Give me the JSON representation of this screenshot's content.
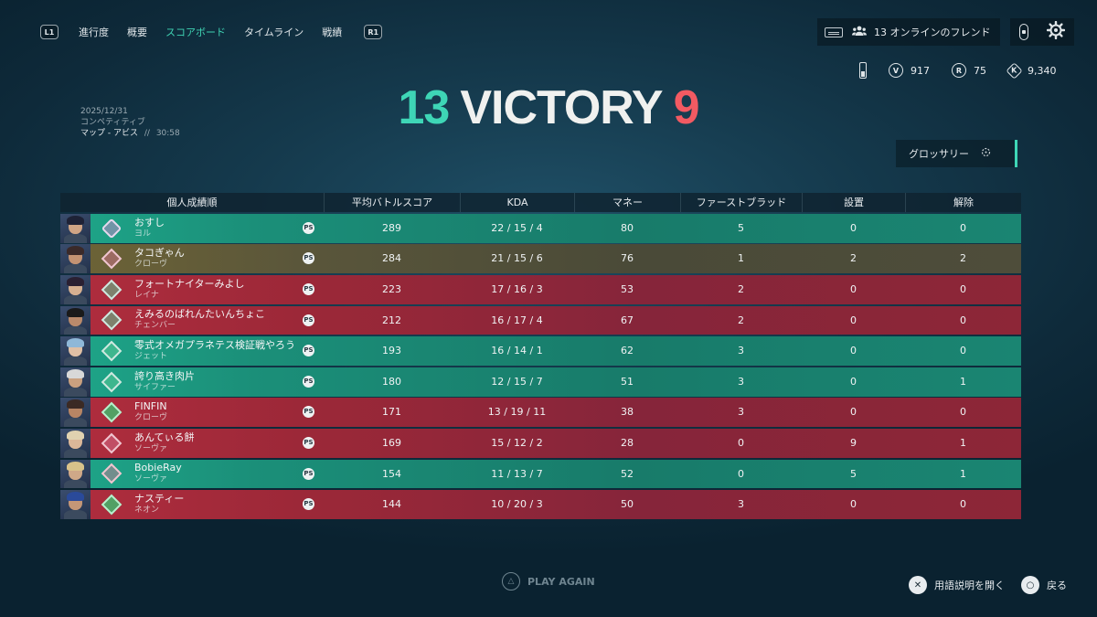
{
  "nav": {
    "left_bumper": "L1",
    "right_bumper": "R1",
    "tabs": [
      {
        "label": "進行度",
        "active": false
      },
      {
        "label": "概要",
        "active": false
      },
      {
        "label": "スコアボード",
        "active": true
      },
      {
        "label": "タイムライン",
        "active": false
      },
      {
        "label": "戦績",
        "active": false
      }
    ]
  },
  "friends": {
    "label": "13 オンラインのフレンド"
  },
  "currencies": [
    {
      "icon": "valorant-points-icon",
      "glyph": "V",
      "value": "917"
    },
    {
      "icon": "radianite-icon",
      "glyph": "R",
      "value": "75"
    },
    {
      "icon": "kingdom-credits-icon",
      "glyph": "K",
      "value": "9,340"
    }
  ],
  "match": {
    "date": "2025/12/31",
    "mode": "コンペティティブ",
    "map": "マップ - アビス",
    "separator": "//",
    "duration": "30:58",
    "score_ally": "13",
    "result": "VICTORY",
    "score_enemy": "9"
  },
  "glossary": {
    "label": "グロッサリー"
  },
  "table": {
    "headers": [
      "個人成績順",
      "平均バトルスコア",
      "KDA",
      "マネー",
      "ファーストブラッド",
      "設置",
      "解除"
    ],
    "rows": [
      {
        "team": "ally",
        "rank": "radiant",
        "name": "おすし",
        "agent": "ヨル",
        "acs": "289",
        "kda": "22 / 15 / 4",
        "money": "80",
        "fb": "5",
        "plants": "0",
        "defuses": "0"
      },
      {
        "team": "self",
        "rank": "star",
        "name": "タコぎゃん",
        "agent": "クローヴ",
        "acs": "284",
        "kda": "21 / 15 / 6",
        "money": "76",
        "fb": "1",
        "plants": "2",
        "defuses": "2"
      },
      {
        "team": "enemy",
        "rank": "ascendant",
        "name": "フォートナイターみよし",
        "agent": "レイナ",
        "acs": "223",
        "kda": "17 / 16 / 3",
        "money": "53",
        "fb": "2",
        "plants": "0",
        "defuses": "0"
      },
      {
        "team": "enemy",
        "rank": "ascendant",
        "name": "えみるのばれんたいんちょこ",
        "agent": "チェンバー",
        "acs": "212",
        "kda": "16 / 17 / 4",
        "money": "67",
        "fb": "2",
        "plants": "0",
        "defuses": "0"
      },
      {
        "team": "ally",
        "rank": "ascendant",
        "name": "零式オメガプラネテス検証戦やろう",
        "agent": "ジェット",
        "acs": "193",
        "kda": "16 / 14 / 1",
        "money": "62",
        "fb": "3",
        "plants": "0",
        "defuses": "0"
      },
      {
        "team": "ally",
        "rank": "ascendant",
        "name": "誇り高き肉片",
        "agent": "サイファー",
        "acs": "180",
        "kda": "12 / 15 / 7",
        "money": "51",
        "fb": "3",
        "plants": "0",
        "defuses": "1"
      },
      {
        "team": "enemy",
        "rank": "emerald",
        "name": "FINFIN",
        "agent": "クローヴ",
        "acs": "171",
        "kda": "13 / 19 / 11",
        "money": "38",
        "fb": "3",
        "plants": "0",
        "defuses": "0"
      },
      {
        "team": "enemy",
        "rank": "star",
        "name": "あんてぃる餅",
        "agent": "ソーヴァ",
        "acs": "169",
        "kda": "15 / 12 / 2",
        "money": "28",
        "fb": "0",
        "plants": "9",
        "defuses": "1"
      },
      {
        "team": "ally",
        "rank": "star",
        "name": "BobieRay",
        "agent": "ソーヴァ",
        "acs": "154",
        "kda": "11 / 13 / 7",
        "money": "52",
        "fb": "0",
        "plants": "5",
        "defuses": "1"
      },
      {
        "team": "enemy",
        "rank": "emerald",
        "name": "ナスティー",
        "agent": "ネオン",
        "acs": "144",
        "kda": "10 / 20 / 3",
        "money": "50",
        "fb": "3",
        "plants": "0",
        "defuses": "0"
      }
    ]
  },
  "footer": {
    "play_again": "PLAY AGAIN",
    "glossary_open": "用語説明を開く",
    "back": "戻る"
  },
  "colors": {
    "ally": "#1b8f79",
    "enemy": "#9c2838",
    "self": "#5a563a",
    "accent": "#3ed6b6",
    "enemy_score": "#f25a62"
  }
}
